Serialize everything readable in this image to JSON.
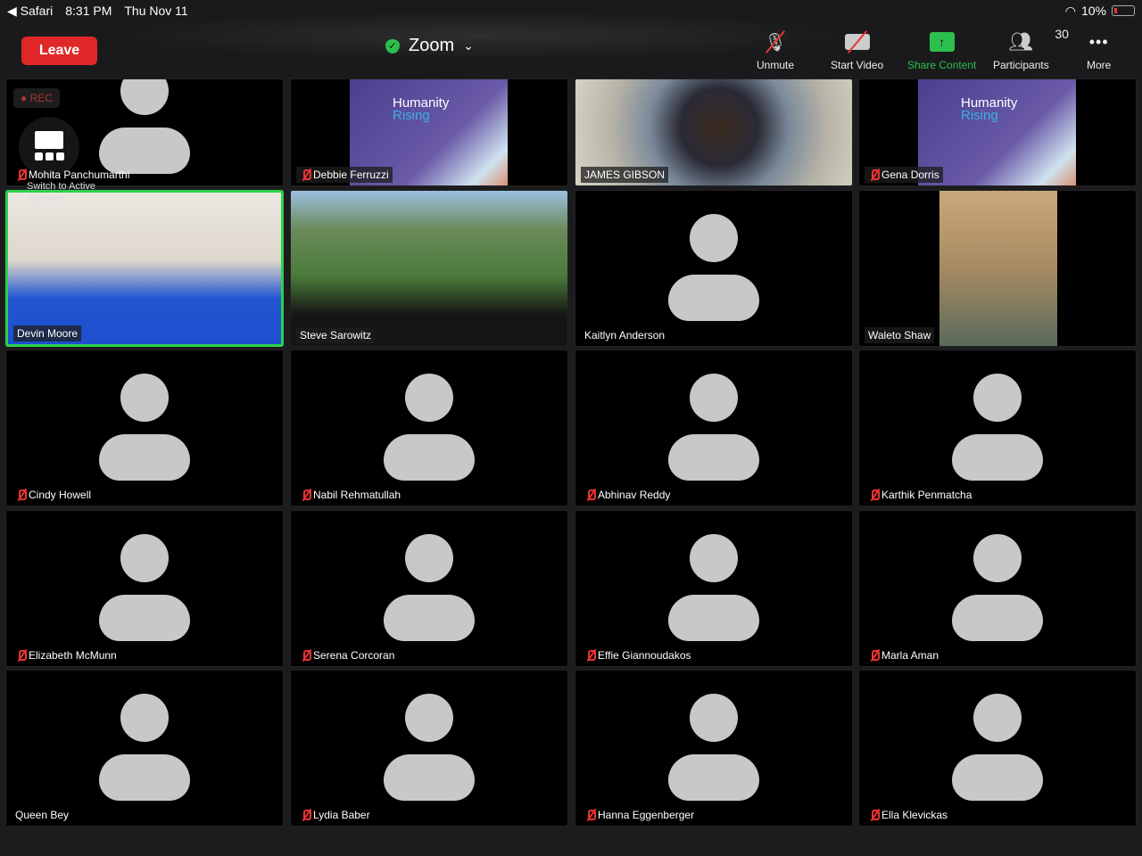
{
  "status_bar": {
    "back_app": "Safari",
    "time": "8:31 PM",
    "date": "Thu Nov 11",
    "battery": "10%"
  },
  "toolbar": {
    "leave": "Leave",
    "title": "Zoom",
    "unmute": "Unmute",
    "start_video": "Start Video",
    "share": "Share Content",
    "participants": "Participants",
    "participant_count": "30",
    "more": "More"
  },
  "overlay": {
    "rec": "REC",
    "switch_label": "Switch to Active Speaker"
  },
  "colors": {
    "leave": "#e02828",
    "accent_green": "#2dbf4e",
    "muted_red": "#e33333"
  },
  "participants": [
    {
      "name": "Mohita Panchumarthi",
      "muted": true,
      "video": "avatar"
    },
    {
      "name": "Debbie Ferruzzi",
      "muted": true,
      "video": "humanity-rising"
    },
    {
      "name": "JAMES GIBSON",
      "muted": false,
      "video": "camera"
    },
    {
      "name": "Gena Dorris",
      "muted": true,
      "video": "humanity-rising"
    },
    {
      "name": "Devin Moore",
      "muted": false,
      "video": "camera",
      "active": true
    },
    {
      "name": "Steve Sarowitz",
      "muted": false,
      "video": "camera"
    },
    {
      "name": "Kaitlyn Anderson",
      "muted": false,
      "video": "avatar"
    },
    {
      "name": "Waleto Shaw",
      "muted": false,
      "video": "camera"
    },
    {
      "name": "Cindy Howell",
      "muted": true,
      "video": "avatar"
    },
    {
      "name": "Nabil Rehmatullah",
      "muted": true,
      "video": "avatar"
    },
    {
      "name": "Abhinav Reddy",
      "muted": true,
      "video": "avatar"
    },
    {
      "name": "Karthik Penmatcha",
      "muted": true,
      "video": "avatar"
    },
    {
      "name": "Elizabeth McMunn",
      "muted": true,
      "video": "avatar"
    },
    {
      "name": "Serena Corcoran",
      "muted": true,
      "video": "avatar"
    },
    {
      "name": "Effie Giannoudakos",
      "muted": true,
      "video": "avatar"
    },
    {
      "name": "Marla Aman",
      "muted": true,
      "video": "avatar"
    },
    {
      "name": "Queen Bey",
      "muted": false,
      "video": "avatar"
    },
    {
      "name": "Lydia Baber",
      "muted": true,
      "video": "avatar"
    },
    {
      "name": "Hanna Eggenberger",
      "muted": true,
      "video": "avatar"
    },
    {
      "name": "Ella Klevickas",
      "muted": true,
      "video": "avatar"
    }
  ],
  "humanity_rising": {
    "line1": "Humanity",
    "line2": "Rising"
  }
}
